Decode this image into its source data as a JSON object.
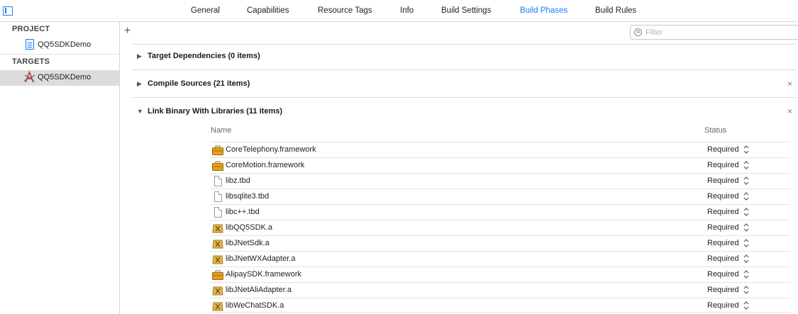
{
  "topbar": {
    "tabs": [
      {
        "label": "General"
      },
      {
        "label": "Capabilities"
      },
      {
        "label": "Resource Tags"
      },
      {
        "label": "Info"
      },
      {
        "label": "Build Settings"
      },
      {
        "label": "Build Phases"
      },
      {
        "label": "Build Rules"
      }
    ],
    "active_tab": "Build Phases"
  },
  "sidebar": {
    "project_header": "PROJECT",
    "project_item": "QQ5SDKDemo",
    "targets_header": "TARGETS",
    "target_item": "QQ5SDKDemo"
  },
  "toolbar": {
    "add_symbol": "+",
    "filter_placeholder": "Filter"
  },
  "phases": [
    {
      "title": "Target Dependencies (0 items)",
      "expanded": false,
      "closable": false
    },
    {
      "title": "Compile Sources (21 items)",
      "expanded": false,
      "closable": true
    },
    {
      "title": "Link Binary With Libraries (11 items)",
      "expanded": true,
      "closable": true
    }
  ],
  "symbols": {
    "collapsed": "▶",
    "expanded": "▼",
    "close": "×"
  },
  "libraries": {
    "name_header": "Name",
    "status_header": "Status",
    "rows": [
      {
        "name": "CoreTelephony.framework",
        "status": "Required",
        "icon": "framework-toolbox-icon"
      },
      {
        "name": "CoreMotion.framework",
        "status": "Required",
        "icon": "framework-toolbox-icon"
      },
      {
        "name": "libz.tbd",
        "status": "Required",
        "icon": "text-file-icon"
      },
      {
        "name": "libsqlite3.tbd",
        "status": "Required",
        "icon": "text-file-icon"
      },
      {
        "name": "libc++.tbd",
        "status": "Required",
        "icon": "text-file-icon"
      },
      {
        "name": "libQQ5SDK.a",
        "status": "Required",
        "icon": "static-library-icon"
      },
      {
        "name": "libJNetSdk.a",
        "status": "Required",
        "icon": "static-library-icon"
      },
      {
        "name": "libJNetWXAdapter.a",
        "status": "Required",
        "icon": "static-library-icon"
      },
      {
        "name": "AlipaySDK.framework",
        "status": "Required",
        "icon": "framework-toolbox-icon"
      },
      {
        "name": "libJNetAliAdapter.a",
        "status": "Required",
        "icon": "static-library-icon"
      },
      {
        "name": "libWeChatSDK.a",
        "status": "Required",
        "icon": "static-library-icon"
      }
    ]
  },
  "colors": {
    "accent": "#1d7df4",
    "selection": "#dcdcdc",
    "framework_icon": "#e8a019",
    "library_icon": "#e6b54a"
  }
}
